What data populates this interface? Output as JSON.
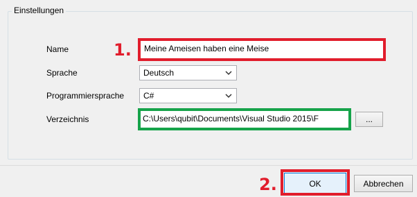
{
  "settings": {
    "group_title": "Einstellungen",
    "name": {
      "label": "Name",
      "value": "Meine Ameisen haben eine Meise"
    },
    "language": {
      "label": "Sprache",
      "selected": "Deutsch"
    },
    "programming_language": {
      "label": "Programmiersprache",
      "selected": "C#"
    },
    "directory": {
      "label": "Verzeichnis",
      "value": "C:\\Users\\qubit\\Documents\\Visual Studio 2015\\F",
      "browse_label": "..."
    }
  },
  "buttons": {
    "ok_label": "OK",
    "cancel_label": "Abbrechen"
  },
  "annotations": {
    "step1": "1.",
    "step2": "2.",
    "colors": {
      "red": "#e11d2c",
      "green": "#16a34a"
    }
  },
  "icons": {
    "dropdown": "chevron-down-icon"
  }
}
